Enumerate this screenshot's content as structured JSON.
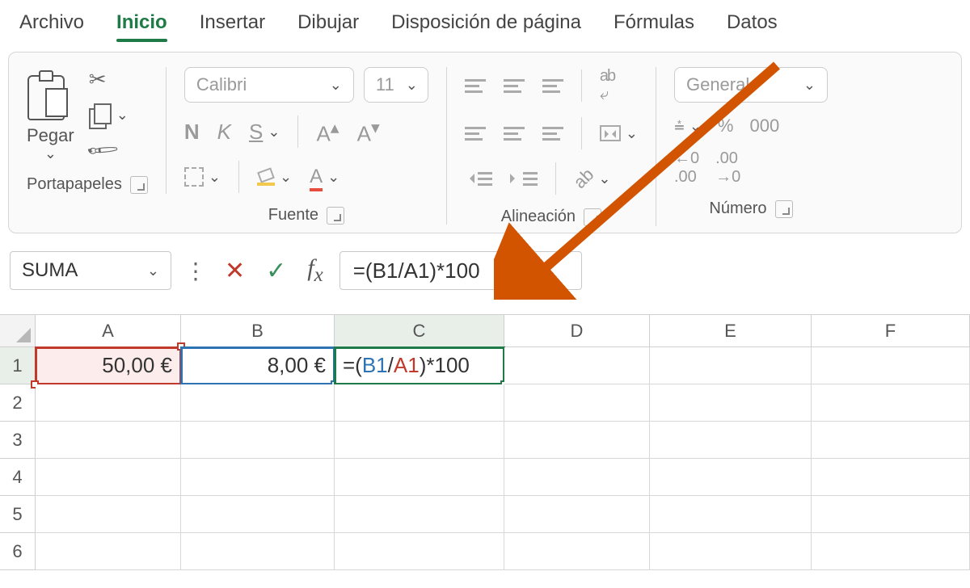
{
  "menu": {
    "items": [
      "Archivo",
      "Inicio",
      "Insertar",
      "Dibujar",
      "Disposición de página",
      "Fórmulas",
      "Datos"
    ],
    "active_index": 1
  },
  "ribbon": {
    "paste_label": "Pegar",
    "group_clipboard": "Portapapeles",
    "group_font": "Fuente",
    "group_align": "Alineación",
    "group_number": "Número",
    "font_name": "Calibri",
    "font_size": "11",
    "bold": "N",
    "italic": "K",
    "underline": "S",
    "grow": "Aˆ",
    "shrink": "Aˇ",
    "number_format": "General",
    "percent": "%",
    "thousands": "000",
    "dec_inc": "←0\n.00",
    "dec_dec": ".00\n→0"
  },
  "formula_bar": {
    "name_box": "SUMA",
    "formula": "=(B1/A1)*100"
  },
  "columns": [
    "A",
    "B",
    "C",
    "D",
    "E",
    "F"
  ],
  "rows": [
    "1",
    "2",
    "3",
    "4",
    "5",
    "6"
  ],
  "cells": {
    "A1": "50,00 €",
    "B1": "8,00 €",
    "C1_prefix": "=(",
    "C1_ref1": "B1",
    "C1_mid": "/",
    "C1_ref2": "A1",
    "C1_suffix": ")*100"
  },
  "colors": {
    "accent": "#1e7a46",
    "ref_red": "#c0392b",
    "ref_blue": "#2e74b5",
    "arrow": "#d35400"
  }
}
